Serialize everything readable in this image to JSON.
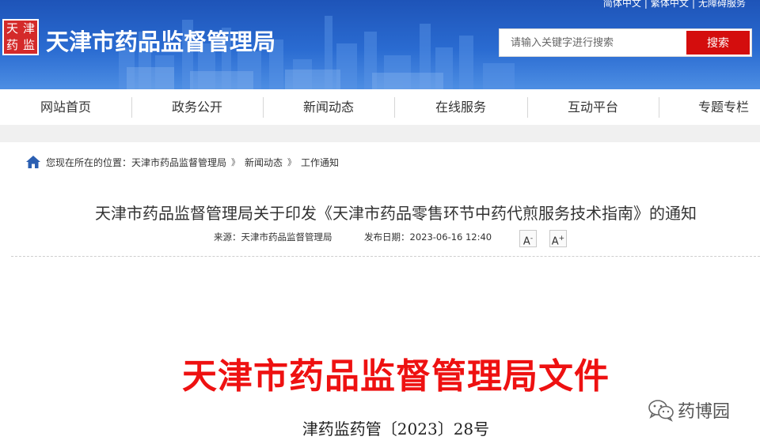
{
  "header": {
    "lang_links": [
      "简体中文",
      "繁体中文",
      "无障碍服务"
    ],
    "seal_chars": [
      "天",
      "津",
      "药",
      "监"
    ],
    "site_title": "天津市药品监督管理局",
    "search_placeholder": "请输入关键字进行搜索",
    "search_button": "搜索",
    "colors": {
      "banner": "#2a6bd1",
      "search_button": "#d40d0d"
    }
  },
  "nav": {
    "items": [
      "网站首页",
      "政务公开",
      "新闻动态",
      "在线服务",
      "互动平台",
      "专题专栏"
    ]
  },
  "breadcrumb": {
    "icon": "home-icon",
    "prefix": "您现在所在的位置：",
    "items": [
      "天津市药品监督管理局",
      "新闻动态",
      "工作通知"
    ],
    "separator": "》"
  },
  "article": {
    "title": "天津市药品监督管理局关于印发《天津市药品零售环节中药代煎服务技术指南》的通知",
    "source_label": "来源：天津市药品监督管理局",
    "date_label": "发布日期：2023-06-16 12:40",
    "font_decrease": "A",
    "font_increase": "A",
    "font_decrease_sup": "-",
    "font_increase_sup": "+"
  },
  "document": {
    "heading": "天津市药品监督管理局文件",
    "number": "津药监药管〔2023〕28号",
    "heading_color": "#ee1111"
  },
  "watermark": {
    "icon": "wechat-icon",
    "text": "药博园"
  }
}
